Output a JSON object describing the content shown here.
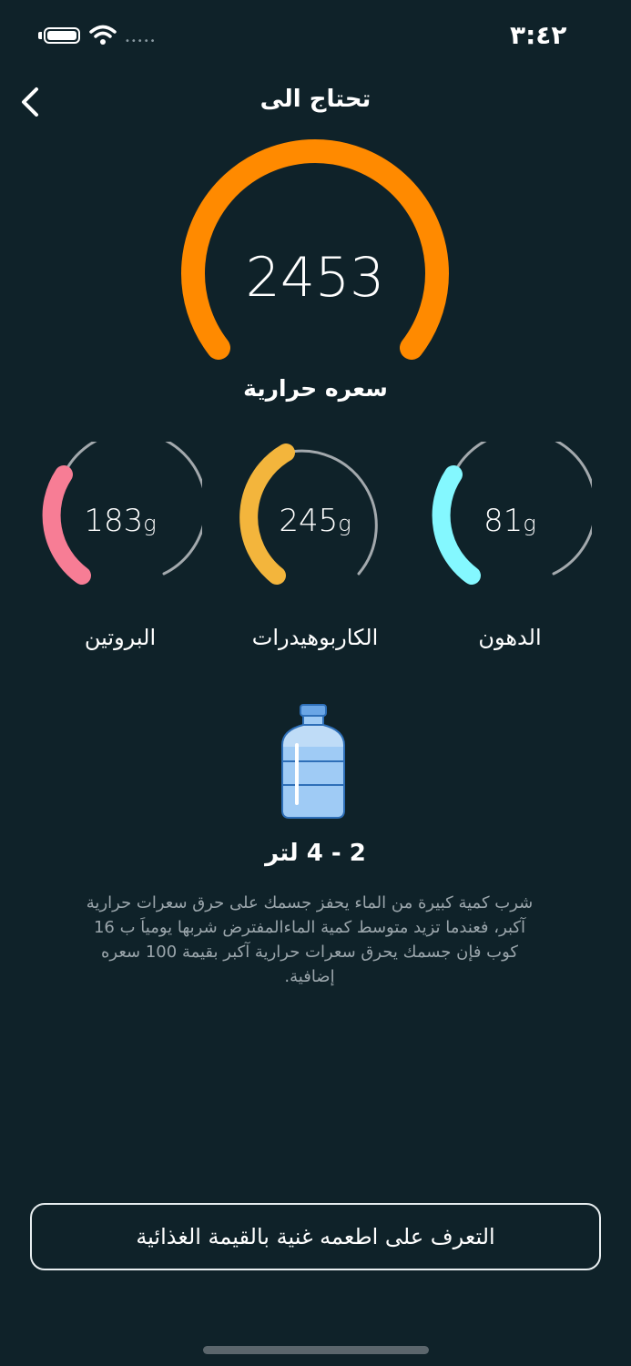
{
  "status_bar": {
    "time": "٣:٤٢",
    "signal_dots": "•••••"
  },
  "header": {
    "title": "تحتاج الى"
  },
  "calories": {
    "value": "2453",
    "label": "سعره حرارية",
    "color": "#ff8a00"
  },
  "macros": [
    {
      "id": "protein",
      "value": "183",
      "unit": "g",
      "label": "البروتين",
      "color": "#f77d95"
    },
    {
      "id": "carbs",
      "value": "245",
      "unit": "g",
      "label": "الكاربوهيدرات",
      "color": "#f3b53c"
    },
    {
      "id": "fat",
      "value": "81",
      "unit": "g",
      "label": "الدهون",
      "color": "#84f8ff"
    }
  ],
  "water": {
    "amount": "2 - 4 لتر",
    "description": "شرب كمية كبيرة من الماء يحفز جسمك على حرق سعرات حرارية آكبر، فعندما تزيد متوسط كمية الماءالمفترض شربها يومياَ ب 16 كوب فإن جسمك يحرق سعرات حرارية آكبر بقيمة 100 سعره إضافية."
  },
  "cta": {
    "label": "التعرف على اطعمه غنية بالقيمة الغذائية"
  }
}
